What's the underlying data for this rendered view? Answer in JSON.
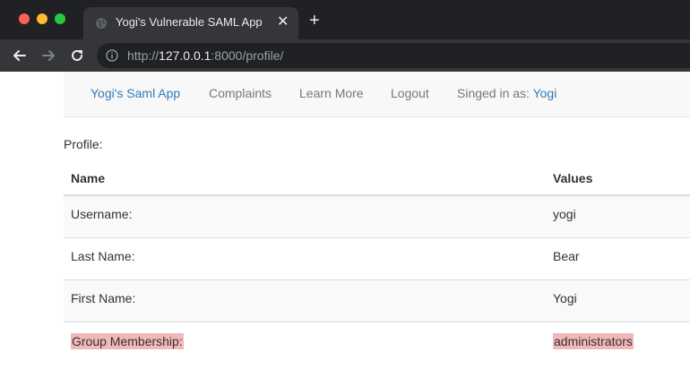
{
  "browser": {
    "tab_title": "Yogi's Vulnerable SAML App",
    "url_scheme": "http://",
    "url_host": "127.0.0.1",
    "url_rest": ":8000/profile/"
  },
  "navbar": {
    "brand": "Yogi's Saml App",
    "complaints": "Complaints",
    "learn_more": "Learn More",
    "logout": "Logout",
    "signed_in_label": "Singed in as: ",
    "signed_in_user": "Yogi"
  },
  "profile": {
    "heading": "Profile:",
    "columns": [
      "Name",
      "Values"
    ],
    "rows": [
      {
        "name": "Username:",
        "value": "yogi"
      },
      {
        "name": "Last Name:",
        "value": "Bear"
      },
      {
        "name": "First Name:",
        "value": "Yogi"
      },
      {
        "name": "Group Membership:",
        "value": "administrators"
      }
    ]
  },
  "colors": {
    "link": "#337ab7",
    "highlight": "#f2b8b8"
  }
}
